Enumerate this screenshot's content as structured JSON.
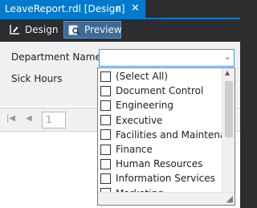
{
  "document_tab": {
    "title": "LeaveReport.rdl [Design]",
    "pin_icon": "pin-icon",
    "close_icon": "close-icon"
  },
  "toolbar": {
    "design_label": "Design",
    "preview_label": "Preview",
    "design_icon": "design-icon",
    "preview_icon": "preview-icon"
  },
  "parameters": {
    "department_label": "Department Name",
    "sick_hours_label": "Sick Hours",
    "department_value": ""
  },
  "navigation": {
    "page_number": "1"
  },
  "dropdown": {
    "items": [
      "(Select All)",
      "Document Control",
      "Engineering",
      "Executive",
      "Facilities and Maintenance",
      "Finance",
      "Human Resources",
      "Information Services",
      "Marketing"
    ]
  },
  "colors": {
    "accent": "#007acc",
    "toolbar_bg": "#2d2d30",
    "selected_button": "#3e6b96"
  }
}
